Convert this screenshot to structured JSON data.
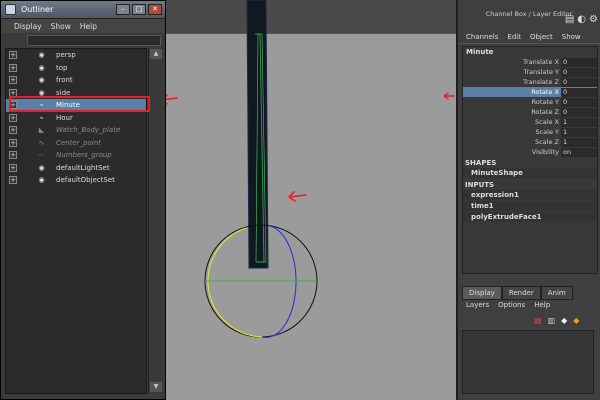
{
  "outliner": {
    "title": "Outliner",
    "menu": [
      "Display",
      "Show",
      "Help"
    ],
    "items": [
      {
        "label": "persp",
        "icon": "camera-icon",
        "dim": false
      },
      {
        "label": "top",
        "icon": "camera-icon",
        "dim": false
      },
      {
        "label": "front",
        "icon": "camera-icon",
        "dim": false
      },
      {
        "label": "side",
        "icon": "camera-icon",
        "dim": false
      },
      {
        "label": "Minute",
        "icon": "nurbs-curve-icon",
        "dim": false,
        "selected": true
      },
      {
        "label": "Hour",
        "icon": "nurbs-curve-icon",
        "dim": false
      },
      {
        "label": "Watch_Body_plate",
        "icon": "mesh-icon",
        "dim": true
      },
      {
        "label": "Center_point",
        "icon": "curve-icon",
        "dim": true
      },
      {
        "label": "Numbers_group",
        "icon": "group-icon",
        "dim": true
      },
      {
        "label": "defaultLightSet",
        "icon": "set-icon",
        "dim": false
      },
      {
        "label": "defaultObjectSet",
        "icon": "set-icon",
        "dim": false
      }
    ]
  },
  "channel_box": {
    "title": "Channel Box / Layer Editor",
    "menu": [
      "Channels",
      "Edit",
      "Object",
      "Show"
    ],
    "node": "Minute",
    "attributes": [
      {
        "name": "Translate X",
        "value": "0"
      },
      {
        "name": "Translate Y",
        "value": "0"
      },
      {
        "name": "Translate Z",
        "value": "0"
      },
      {
        "name": "Rotate X",
        "value": "0",
        "selected": true
      },
      {
        "name": "Rotate Y",
        "value": "0"
      },
      {
        "name": "Rotate Z",
        "value": "0"
      },
      {
        "name": "Scale X",
        "value": "1"
      },
      {
        "name": "Scale Y",
        "value": "1"
      },
      {
        "name": "Scale Z",
        "value": "1"
      },
      {
        "name": "Visibility",
        "value": "on"
      }
    ],
    "shapes_label": "SHAPES",
    "shape": "MinuteShape",
    "inputs_label": "INPUTS",
    "inputs": [
      "expression1",
      "time1",
      "polyExtrudeFace1"
    ]
  },
  "layer_editor": {
    "tabs": [
      "Display",
      "Render",
      "Anim"
    ],
    "active_tab": "Display",
    "menu": [
      "Layers",
      "Options",
      "Help"
    ]
  },
  "colors": {
    "selection": "#5c7fa8",
    "annotation": "#e0202a"
  }
}
